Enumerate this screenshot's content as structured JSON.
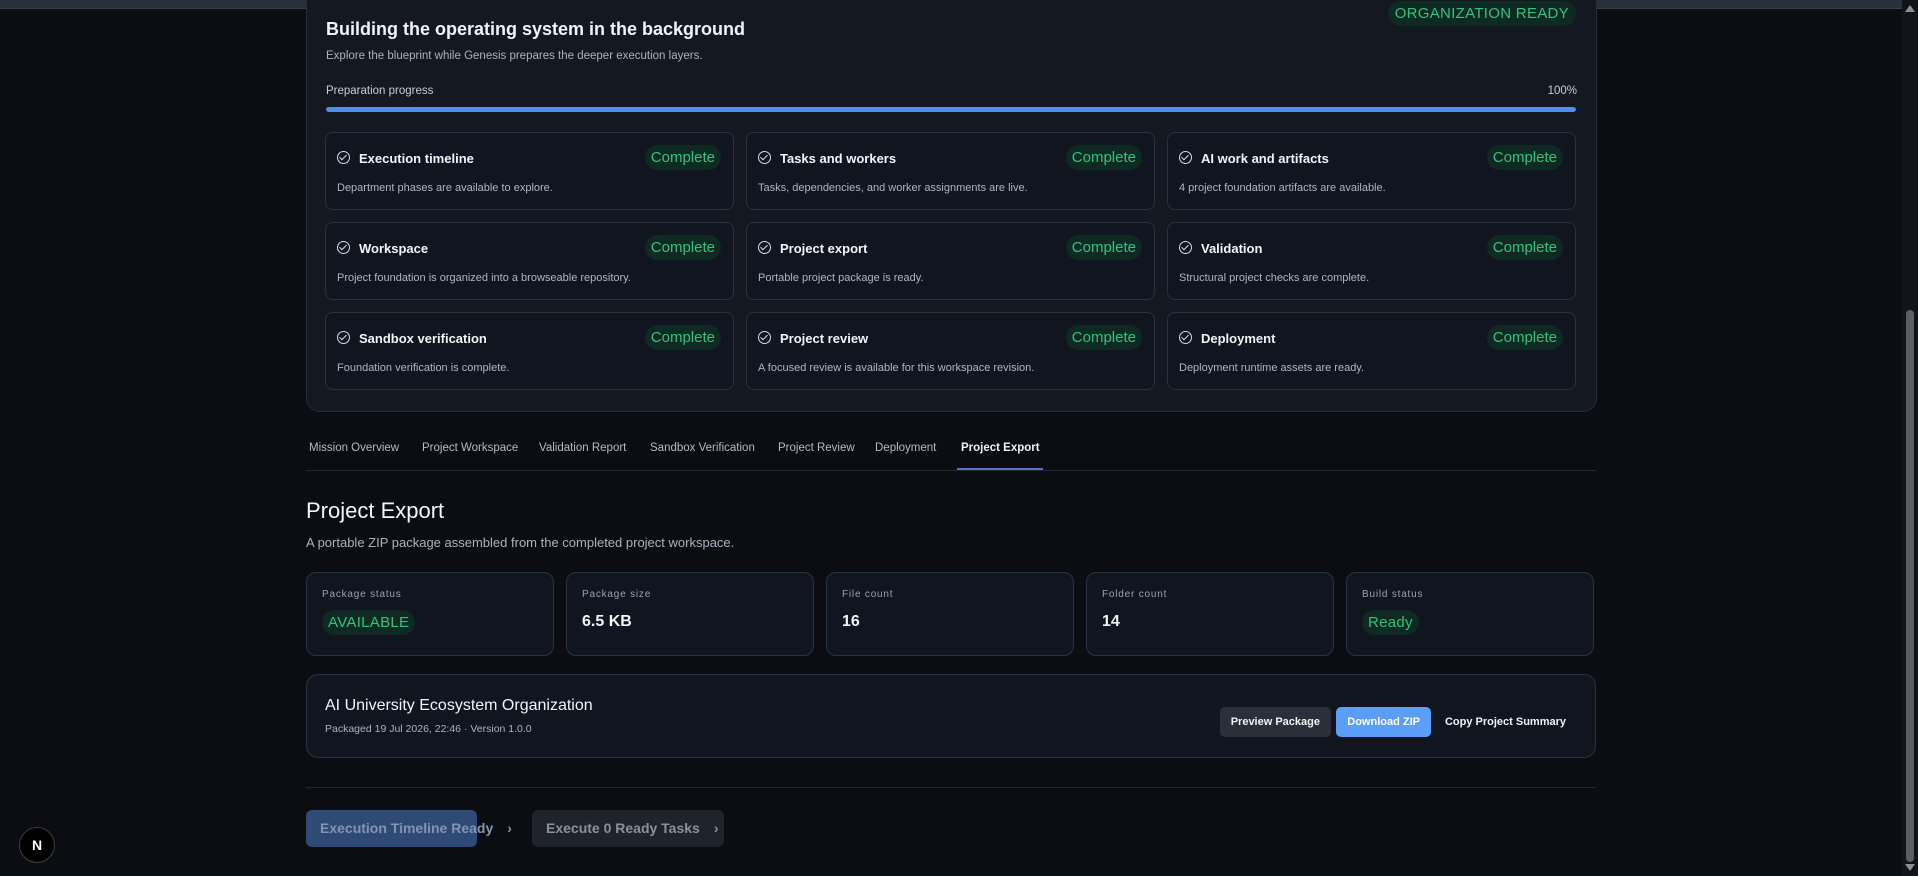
{
  "prep": {
    "title": "Building the operating system in the background",
    "subtitle": "Explore the blueprint while Genesis prepares the deeper execution layers.",
    "org_badge": "ORGANIZATION READY",
    "progress_label": "Preparation progress",
    "progress_text": "100%",
    "progress_fraction": 1.0,
    "steps": [
      {
        "title": "Execution timeline",
        "status": "Complete",
        "desc": "Department phases are available to explore."
      },
      {
        "title": "Tasks and workers",
        "status": "Complete",
        "desc": "Tasks, dependencies, and worker assignments are live."
      },
      {
        "title": "AI work and artifacts",
        "status": "Complete",
        "desc": "4 project foundation artifacts are available."
      },
      {
        "title": "Workspace",
        "status": "Complete",
        "desc": "Project foundation is organized into a browseable repository."
      },
      {
        "title": "Project export",
        "status": "Complete",
        "desc": "Portable project package is ready."
      },
      {
        "title": "Validation",
        "status": "Complete",
        "desc": "Structural project checks are complete."
      },
      {
        "title": "Sandbox verification",
        "status": "Complete",
        "desc": "Foundation verification is complete."
      },
      {
        "title": "Project review",
        "status": "Complete",
        "desc": "A focused review is available for this workspace revision."
      },
      {
        "title": "Deployment",
        "status": "Complete",
        "desc": "Deployment runtime assets are ready."
      }
    ]
  },
  "tabs": [
    {
      "label": "Mission Overview"
    },
    {
      "label": "Project Workspace"
    },
    {
      "label": "Validation Report"
    },
    {
      "label": "Sandbox Verification"
    },
    {
      "label": "Project Review"
    },
    {
      "label": "Deployment"
    },
    {
      "label": "Project Export"
    }
  ],
  "active_tab": "Project Export",
  "export": {
    "title": "Project Export",
    "subtitle": "A portable ZIP package assembled from the completed project workspace.",
    "stats": [
      {
        "label": "Package status",
        "value": "AVAILABLE",
        "kind": "badge"
      },
      {
        "label": "Package size",
        "value": "6.5 KB",
        "kind": "text"
      },
      {
        "label": "File count",
        "value": "16",
        "kind": "text"
      },
      {
        "label": "Folder count",
        "value": "14",
        "kind": "text"
      },
      {
        "label": "Build status",
        "value": "Ready",
        "kind": "badge"
      }
    ],
    "package": {
      "name": "AI University Ecosystem Organization",
      "meta": "Packaged 19 Jul 2026, 22:46 · Version 1.0.0",
      "preview_label": "Preview Package",
      "download_label": "Download ZIP",
      "copy_label": "Copy Project Summary"
    }
  },
  "actions": {
    "timeline_label": "Execution Timeline Ready",
    "execute_label": "Execute 0 Ready Tasks"
  },
  "fab_label": "N",
  "colors": {
    "background": "#0b0d12",
    "card": "#141821",
    "success": "#34c27e",
    "accent": "#5a9ef7",
    "progress": "#4f8ef0"
  }
}
